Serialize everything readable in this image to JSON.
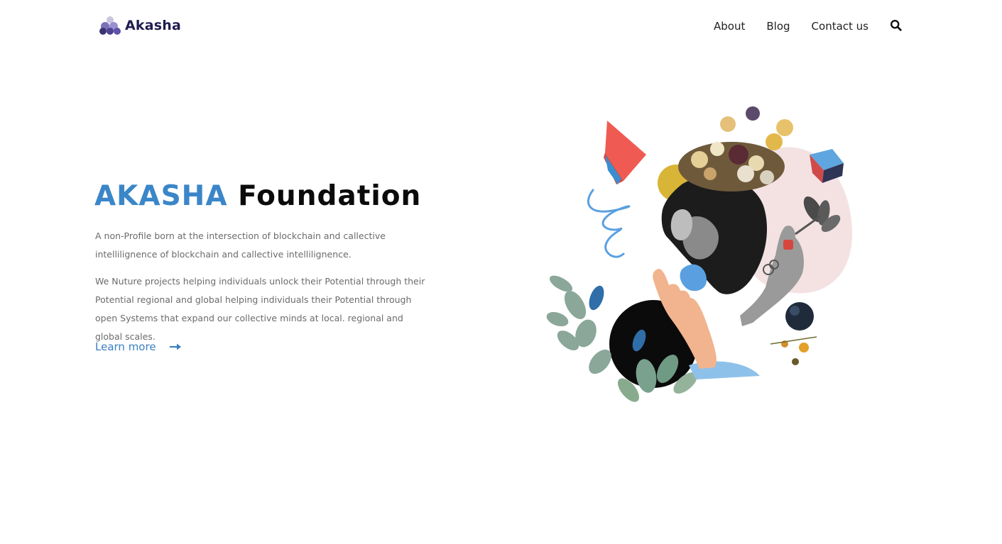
{
  "header": {
    "logo_text": "Akasha",
    "nav": {
      "about": "About",
      "blog": "Blog",
      "contact": "Contact us"
    },
    "search_icon": "search-icon"
  },
  "hero": {
    "title_accent": "AKASHA",
    "title_rest": "Foundation",
    "paragraph1": "A non-Profile born at the intersection of blockchain and callective intellilignence of blockchain and callective intellilignence.",
    "paragraph2": "We Nuture projects helping individuals unlock their Potential through their Potential regional and global helping individuals their Potential through open Systems that expand our collective minds at local. regional and global scales.",
    "cta_label": "Learn more",
    "cta_icon": "arrow-right-icon"
  },
  "colors": {
    "accent": "#3a86c8",
    "logo": "#1f1d4f",
    "text_muted": "#6b6b6b"
  }
}
